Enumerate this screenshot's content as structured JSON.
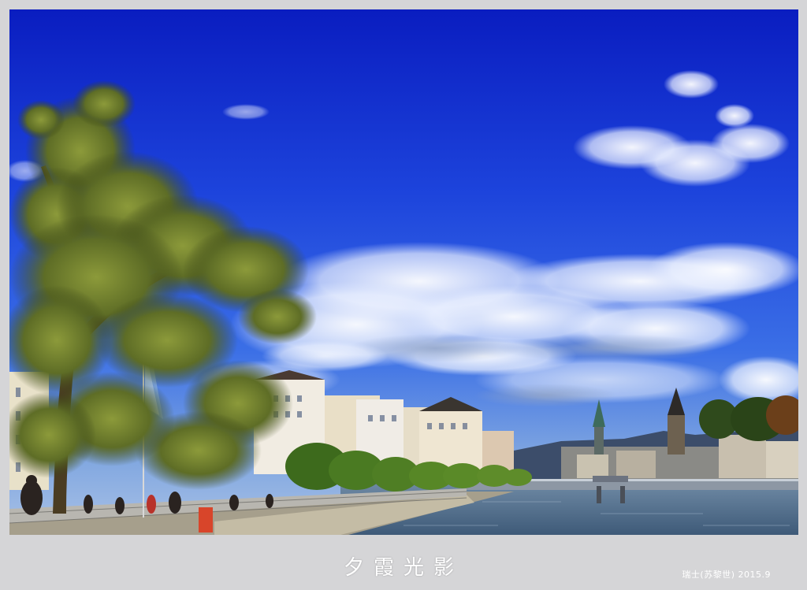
{
  "caption": {
    "title": "夕霞光影"
  },
  "credit": {
    "text": "瑞士(苏黎世) 2015.9"
  },
  "colors": {
    "sky_top": "#0b1fc4",
    "sky_mid": "#2a5be8",
    "sky_low": "#6a9be6",
    "water": "#4f6f8f",
    "foliage": "#6a7a2a",
    "mat": "#d5d5d7"
  }
}
